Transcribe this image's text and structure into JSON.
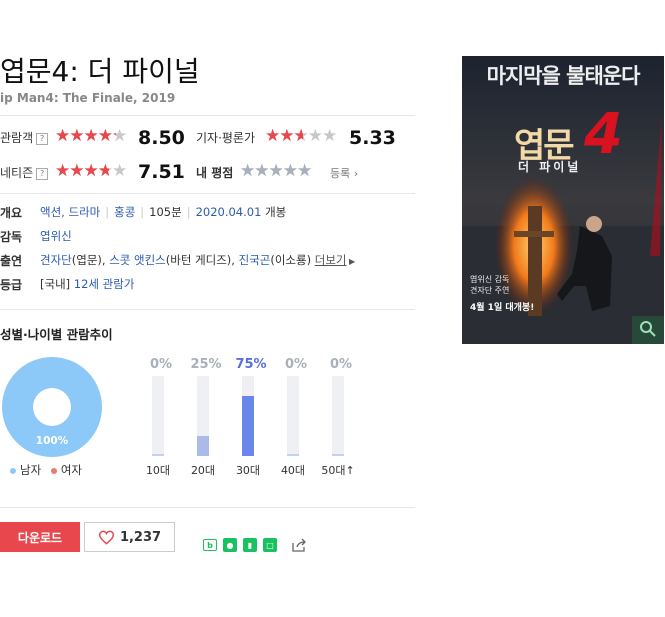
{
  "movie": {
    "title": "엽문4: 더 파이널",
    "subtitle": "ip Man4: The Finale, 2019"
  },
  "ratings": {
    "audience": {
      "label": "관람객",
      "score": "8.50",
      "value": 8.5
    },
    "critic": {
      "label": "기자·평론가",
      "score": "5.33",
      "value": 5.33
    },
    "netizen": {
      "label": "네티즌",
      "score": "7.51",
      "value": 7.51
    },
    "my_rating": {
      "label": "내 평점",
      "register": "등록"
    },
    "help_mark": "?"
  },
  "info": {
    "overview_label": "개요",
    "genre1": "액션",
    "genre2": "드라마",
    "country": "홍콩",
    "runtime": "105분",
    "release_date": "2020.04.01",
    "release_suffix": "개봉",
    "director_label": "감독",
    "director": "엽위신",
    "cast_label": "출연",
    "cast": [
      {
        "name": "견자단",
        "role": "(엽문)"
      },
      {
        "name": "스콧 앳킨스",
        "role": "(바턴 게디즈)"
      },
      {
        "name": "진국곤",
        "role": "(이소룡)"
      }
    ],
    "more": "더보기",
    "grade_label": "등급",
    "grade_domestic": "[국내]",
    "grade": "12세 관람가"
  },
  "trend": {
    "title": "성별·나이별 관람추이",
    "gender": {
      "male_pct": "100%",
      "male_value": 100,
      "male_label": "남자",
      "female_label": "여자"
    },
    "ages": [
      {
        "label": "10대",
        "pct": "0%",
        "value": 0
      },
      {
        "label": "20대",
        "pct": "25%",
        "value": 25
      },
      {
        "label": "30대",
        "pct": "75%",
        "value": 75
      },
      {
        "label": "40대",
        "pct": "0%",
        "value": 0
      },
      {
        "label": "50대↑",
        "pct": "0%",
        "value": 0
      }
    ]
  },
  "actions": {
    "download": "다운로드",
    "likes": "1,237"
  },
  "poster": {
    "top_text": "마지막을 불태운다",
    "logo": "엽문",
    "logo_num": "4",
    "logo_sub": "더 파이널",
    "credits1": "엽위신 감독",
    "credits2": "견자단 주연",
    "release": "4월 1일 대개봉!"
  },
  "colors": {
    "star_red": "#e8484d",
    "star_gray": "#c8c8c8",
    "star_dim": "#a8b0bb",
    "male": "#8cc8f8",
    "female": "#f07a6a",
    "bar_light": "#aabbe8",
    "bar_strong": "#6b86ea",
    "pct_gray": "#a8b0bb",
    "pct_strong": "#5a6ee0",
    "download": "#e8484d"
  }
}
